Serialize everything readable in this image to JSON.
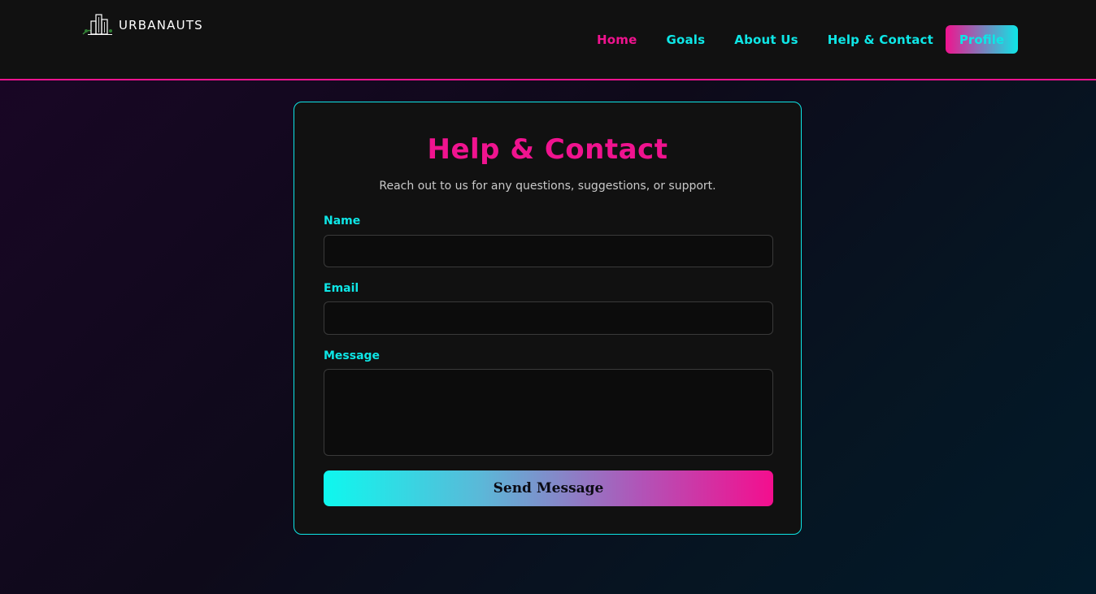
{
  "header": {
    "logo_text": "URBANAUTS",
    "logo_icon": "city-buildings-icon",
    "nav": [
      {
        "label": "Home",
        "active": true
      },
      {
        "label": "Goals",
        "active": false
      },
      {
        "label": "About Us",
        "active": false
      },
      {
        "label": "Help & Contact",
        "active": false
      }
    ],
    "profile_label": "Profile"
  },
  "contact": {
    "title": "Help & Contact",
    "subtitle": "Reach out to us for any questions, suggestions, or support.",
    "name_label": "Name",
    "name_value": "",
    "email_label": "Email",
    "email_value": "",
    "message_label": "Message",
    "message_value": "",
    "submit_label": "Send Message"
  },
  "colors": {
    "accent_pink": "#f0138f",
    "accent_cyan": "#0ee6e6",
    "surface": "#111111"
  }
}
